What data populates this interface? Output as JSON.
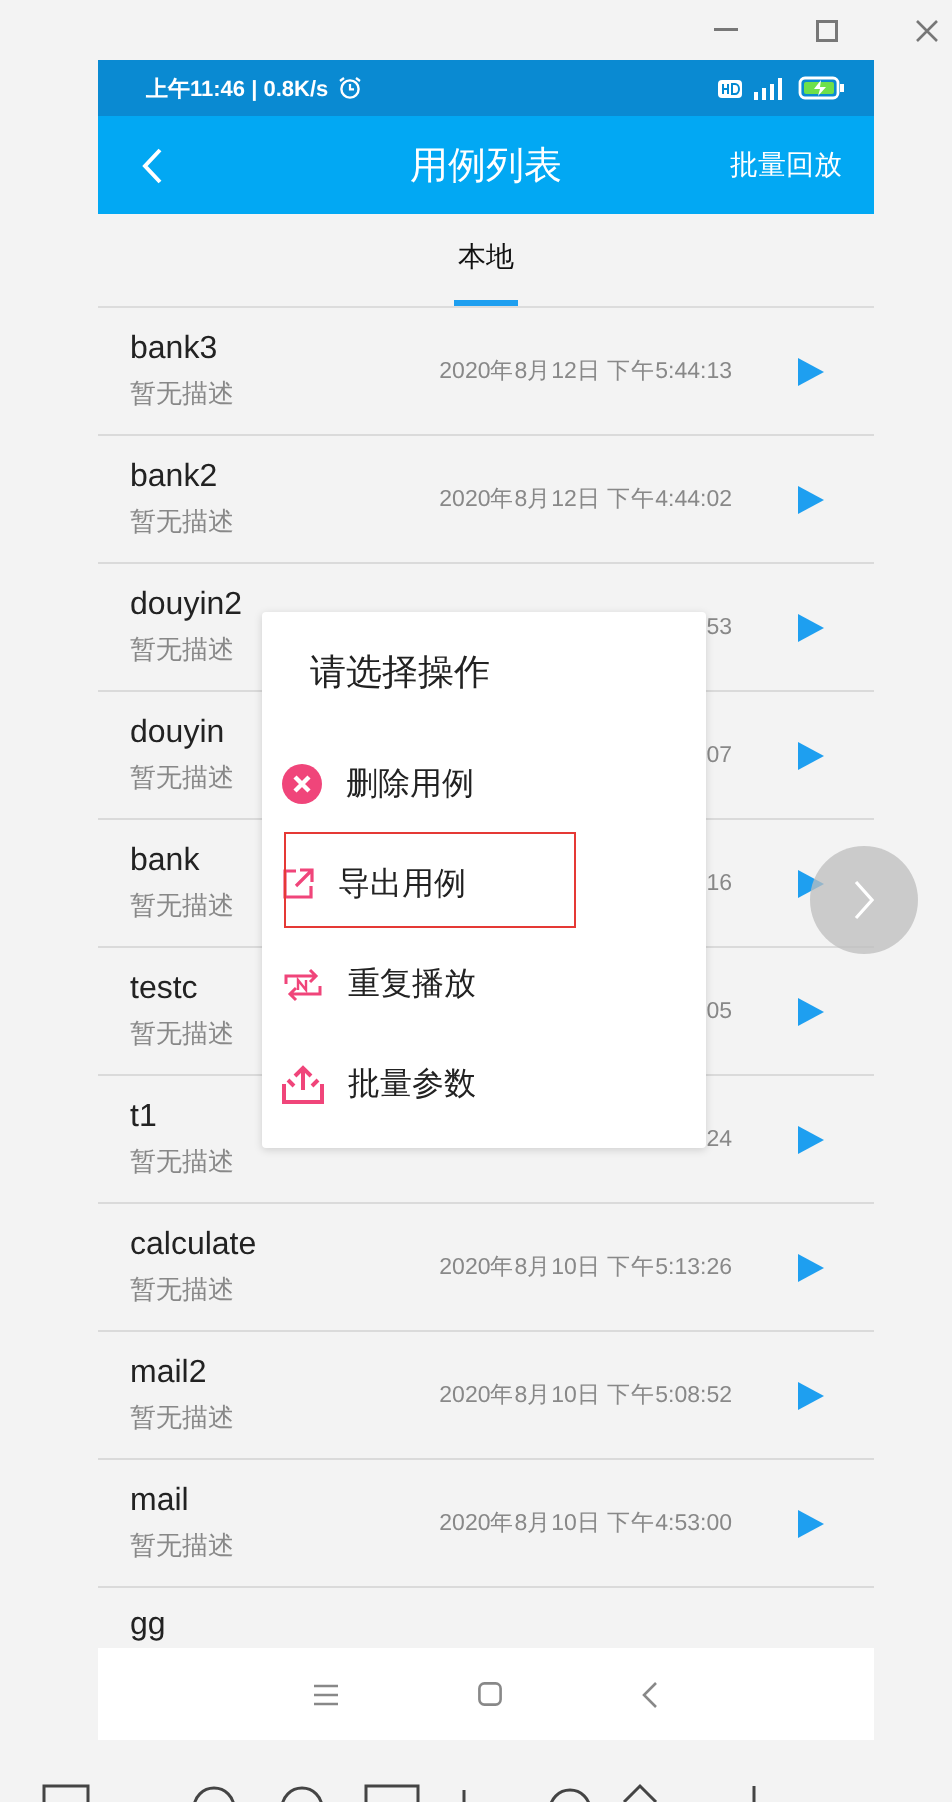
{
  "status_bar": {
    "text": "上午11:46 | 0.8K/s"
  },
  "app_bar": {
    "title": "用例列表",
    "action": "批量回放"
  },
  "tabs": [
    {
      "label": "本地",
      "selected": true
    }
  ],
  "cases": [
    {
      "name": "bank3",
      "description": "暂无描述",
      "time": "2020年8月12日 下午5:44:13"
    },
    {
      "name": "bank2",
      "description": "暂无描述",
      "time": "2020年8月12日 下午4:44:02"
    },
    {
      "name": "douyin2",
      "description": "暂无描述",
      "time": "53"
    },
    {
      "name": "douyin",
      "description": "暂无描述",
      "time": "07"
    },
    {
      "name": "bank",
      "description": "暂无描述",
      "time": "16"
    },
    {
      "name": "testc",
      "description": "暂无描述",
      "time": "05"
    },
    {
      "name": "t1",
      "description": "暂无描述",
      "time": "24"
    },
    {
      "name": "calculate",
      "description": "暂无描述",
      "time": "2020年8月10日 下午5:13:26"
    },
    {
      "name": "mail2",
      "description": "暂无描述",
      "time": "2020年8月10日 下午5:08:52"
    },
    {
      "name": "mail",
      "description": "暂无描述",
      "time": "2020年8月10日 下午4:53:00"
    },
    {
      "name": "gg"
    }
  ],
  "dialog": {
    "title": "请选择操作",
    "items": [
      {
        "label": "删除用例",
        "kind": "delete",
        "marked": false
      },
      {
        "label": "导出用例",
        "kind": "export",
        "marked": true
      },
      {
        "label": "重复播放",
        "kind": "repeat",
        "marked": false
      },
      {
        "label": "批量参数",
        "kind": "batch",
        "marked": false
      }
    ]
  }
}
